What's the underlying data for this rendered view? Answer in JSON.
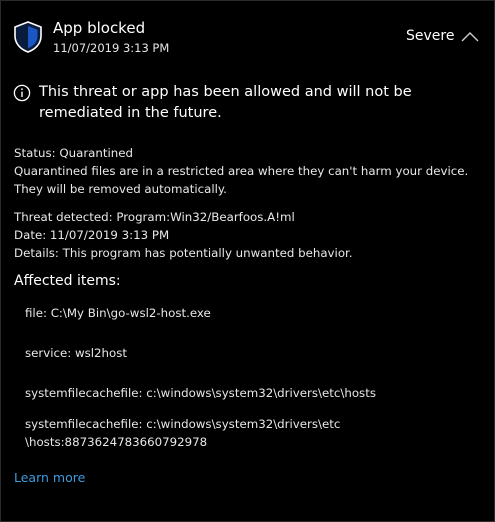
{
  "header": {
    "title": "App blocked",
    "timestamp": "11/07/2019 3:13 PM",
    "severity": "Severe",
    "shield_icon": "shield-icon",
    "collapse_icon": "chevron-up-icon"
  },
  "notice": {
    "icon": "info-icon",
    "text": "This threat or app has been allowed and will not be remediated in the future."
  },
  "status": {
    "label": "Status:",
    "value": "Quarantined",
    "description": "Quarantined files are in a restricted area where they can't harm your device. They will be removed automatically."
  },
  "threat": {
    "detected_label": "Threat detected:",
    "detected_value": "Program:Win32/Bearfoos.A!ml",
    "date_label": "Date:",
    "date_value": "11/07/2019 3:13 PM",
    "details_label": "Details:",
    "details_value": "This program has potentially unwanted behavior."
  },
  "affected": {
    "title": "Affected items:",
    "items": [
      "file: C:\\My Bin\\go-wsl2-host.exe",
      "service: wsl2host",
      "systemfilecachefile: c:\\windows\\system32\\drivers\\etc\\hosts",
      "systemfilecachefile: c:\\windows\\system32\\drivers\\etc\n\\hosts:8873624783660792978"
    ]
  },
  "learn_more": "Learn more",
  "colors": {
    "background": "#000000",
    "text": "#ffffff",
    "link": "#3a9bdc",
    "shield": "#1b57c2"
  }
}
